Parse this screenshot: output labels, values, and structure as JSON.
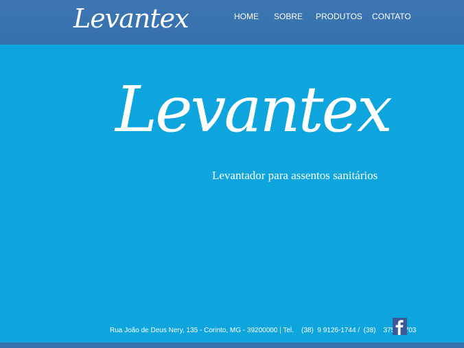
{
  "header": {
    "brand": "Levantex",
    "nav": [
      {
        "label": "HOME"
      },
      {
        "label": "SOBRE"
      },
      {
        "label": "PRODUTOS"
      },
      {
        "label": "CONTATO"
      }
    ]
  },
  "hero": {
    "logo_text": "Levantex",
    "tagline": "Levantador para assentos sanitários"
  },
  "footer": {
    "address": "Rua João de Deus Nery, 135 - Corinto, MG - 39200000 | Tel.    (38)  9 9126-1744 /  (38)    3751-2703",
    "social_icon": "facebook-icon"
  },
  "colors": {
    "header_bg": "#3570ad",
    "page_bg": "#0ea5df",
    "text": "#ffffff",
    "facebook": "#3b5998"
  }
}
